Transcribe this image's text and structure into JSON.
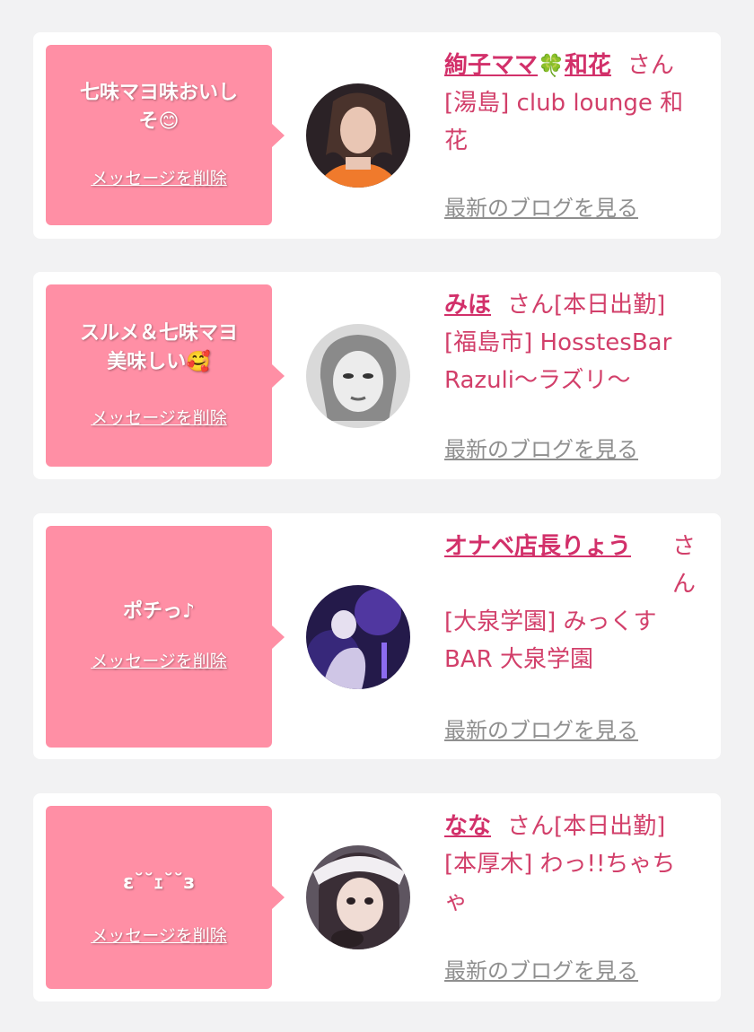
{
  "common": {
    "delete_label": "メッセージを削除",
    "blog_label": "最新のブログを見る",
    "honorific": "さん"
  },
  "colors": {
    "page_bg": "#f2f2f3",
    "bubble": "#ff8fa5",
    "accent_text": "#d23f6a",
    "link_gray": "#8f8f8f"
  },
  "items": [
    {
      "message_line1": "七味マヨ味おいし",
      "message_line2": "そ😊",
      "name_part1": "絢子ママ",
      "name_icon": "🍀",
      "name_part2": "和花",
      "shop_line1": "[湯島] club lounge 和",
      "shop_line2": "花",
      "avatar_icon": "woman-photo-avatar"
    },
    {
      "message_line1": "スルメ＆七味マヨ",
      "message_line2": "美味しい🥰",
      "name": "みほ",
      "status": "[本日出勤]",
      "shop_line1": "[福島市] HosstesBar",
      "shop_line2": "Razuli〜ラズリ〜",
      "avatar_icon": "monochrome-woman-avatar"
    },
    {
      "message": "ポチっ♪",
      "name": "オナベ店長りょう",
      "shop_line1": "[大泉学園] みっくす",
      "shop_line2": "BAR 大泉学園",
      "avatar_icon": "purple-bar-avatar"
    },
    {
      "message": "ε˘˘ｪ˘˘з",
      "name": "なな",
      "status": "[本日出勤]",
      "shop_line1": "[本厚木] わっ!!ちゃち",
      "shop_line2": "ゃ",
      "avatar_icon": "lace-woman-avatar"
    }
  ]
}
